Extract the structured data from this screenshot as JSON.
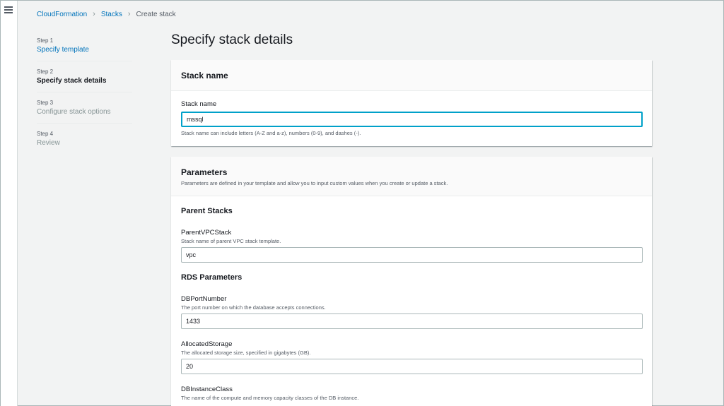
{
  "nav": {
    "menu_icon": "hamburger-menu-icon"
  },
  "breadcrumb": {
    "items": [
      "CloudFormation",
      "Stacks",
      "Create stack"
    ],
    "separator_icon": "chevron-right-icon"
  },
  "steps": [
    {
      "number": "Step 1",
      "label": "Specify template"
    },
    {
      "number": "Step 2",
      "label": "Specify stack details"
    },
    {
      "number": "Step 3",
      "label": "Configure stack options"
    },
    {
      "number": "Step 4",
      "label": "Review"
    }
  ],
  "page": {
    "title": "Specify stack details"
  },
  "stack_name_panel": {
    "header": "Stack name",
    "field_label": "Stack name",
    "value": "mssql",
    "constraint": "Stack name can include letters (A-Z and a-z), numbers (0-9), and dashes (-)."
  },
  "parameters_panel": {
    "header": "Parameters",
    "description": "Parameters are defined in your template and allow you to input custom values when you create or update a stack.",
    "sections": {
      "parent": {
        "title": "Parent Stacks",
        "vpc": {
          "label": "ParentVPCStack",
          "description": "Stack name of parent VPC stack template.",
          "value": "vpc"
        }
      },
      "rds": {
        "title": "RDS Parameters",
        "port": {
          "label": "DBPortNumber",
          "description": "The port number on which the database accepts connections.",
          "value": "1433"
        },
        "storage": {
          "label": "AllocatedStorage",
          "description": "The allocated storage size, specified in gigabytes (GB).",
          "value": "20"
        },
        "instance_class": {
          "label": "DBInstanceClass",
          "description": "The name of the compute and memory capacity classes of the DB instance."
        }
      }
    }
  },
  "colors": {
    "link": "#0073bb",
    "focus": "#00a1c9",
    "page_bg": "#f2f3f3"
  }
}
